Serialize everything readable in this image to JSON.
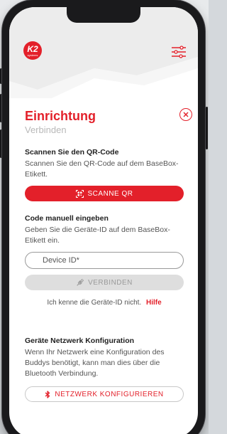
{
  "brand": {
    "logo_text": "K2",
    "logo_sub": "systems",
    "accent_color": "#e3202a"
  },
  "header": {
    "title": "Einrichtung",
    "subtitle": "Verbinden",
    "menu_icon": "sliders-icon",
    "close_icon": "close-icon"
  },
  "qr_section": {
    "heading": "Scannen Sie den QR-Code",
    "text": "Scannen Sie den QR-Code auf dem BaseBox-Etikett.",
    "button_label": "SCANNE QR",
    "button_icon": "qr-scan-icon"
  },
  "manual_section": {
    "heading": "Code manuell eingeben",
    "text": "Geben Sie die Geräte-ID auf dem BaseBox-Etikett ein.",
    "input_placeholder": "Device ID*",
    "connect_label": "VERBINDEN",
    "connect_icon": "plug-icon",
    "help_text": "Ich kenne die Geräte-ID nicht.",
    "help_link": "Hilfe"
  },
  "network_section": {
    "heading": "Geräte Netzwerk Konfiguration",
    "text": "Wenn Ihr Netzwerk eine Konfiguration des Buddys benötigt, kann man dies über die Bluetooth Verbindung.",
    "button_label": "NETZWERK KONFIGURIEREN",
    "button_icon": "bluetooth-icon"
  }
}
